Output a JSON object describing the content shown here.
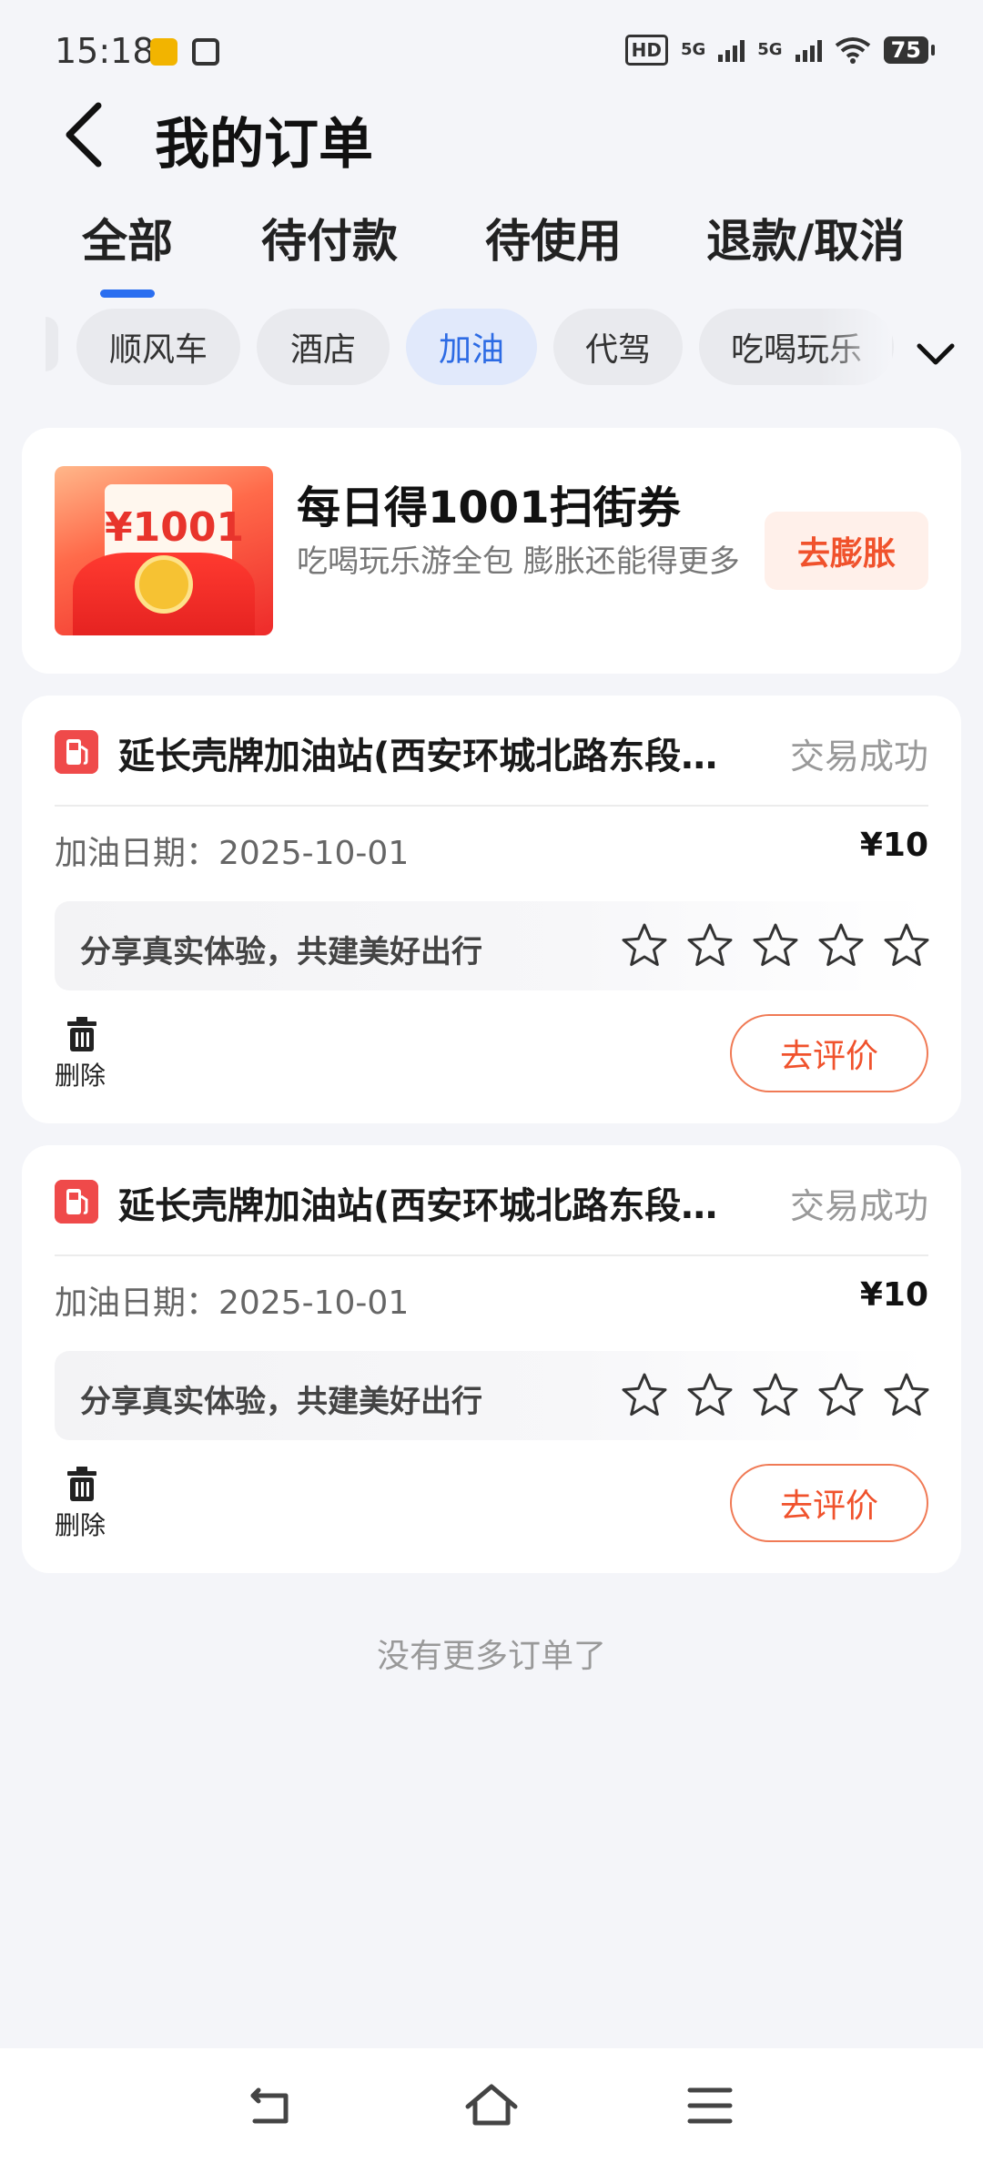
{
  "status_bar": {
    "time": "15:18",
    "hd_label": "HD",
    "network_1": "5G",
    "network_2": "5G",
    "battery": "75"
  },
  "header": {
    "title": "我的订单"
  },
  "tabs": [
    "全部",
    "待付款",
    "待使用",
    "退款/取消"
  ],
  "active_tab": "全部",
  "filter_chips": [
    "顺风车",
    "酒店",
    "加油",
    "代驾",
    "吃喝玩乐"
  ],
  "active_chip": "加油",
  "promo": {
    "image_value": "¥1001",
    "title": "每日得1001扫街券",
    "description": "吃喝玩乐游全包 膨胀还能得更多",
    "button": "去膨胀"
  },
  "orders": [
    {
      "store_name": "延长壳牌加油站(西安环城北路东段…",
      "status": "交易成功",
      "date_label": "加油日期：",
      "date": "2025-10-01",
      "price": "¥10",
      "review_prompt": "分享真实体验，共建美好出行",
      "rating": 0,
      "delete_label": "删除",
      "review_button": "去评价"
    },
    {
      "store_name": "延长壳牌加油站(西安环城北路东段…",
      "status": "交易成功",
      "date_label": "加油日期：",
      "date": "2025-10-01",
      "price": "¥10",
      "review_prompt": "分享真实体验，共建美好出行",
      "rating": 0,
      "delete_label": "删除",
      "review_button": "去评价"
    }
  ],
  "footer": {
    "no_more": "没有更多订单了"
  },
  "icons": {
    "back": "chevron-left-icon",
    "expand": "chevron-down-icon",
    "gas_station": "gas-station-icon",
    "star": "star-outline-icon",
    "delete": "trash-icon",
    "nav_back": "back-arrow-icon",
    "nav_home": "home-icon",
    "nav_menu": "menu-icon"
  },
  "colors": {
    "accent_blue": "#2a6ef0",
    "accent_orange": "#f0522c",
    "gas_red": "#ef4a4a"
  }
}
